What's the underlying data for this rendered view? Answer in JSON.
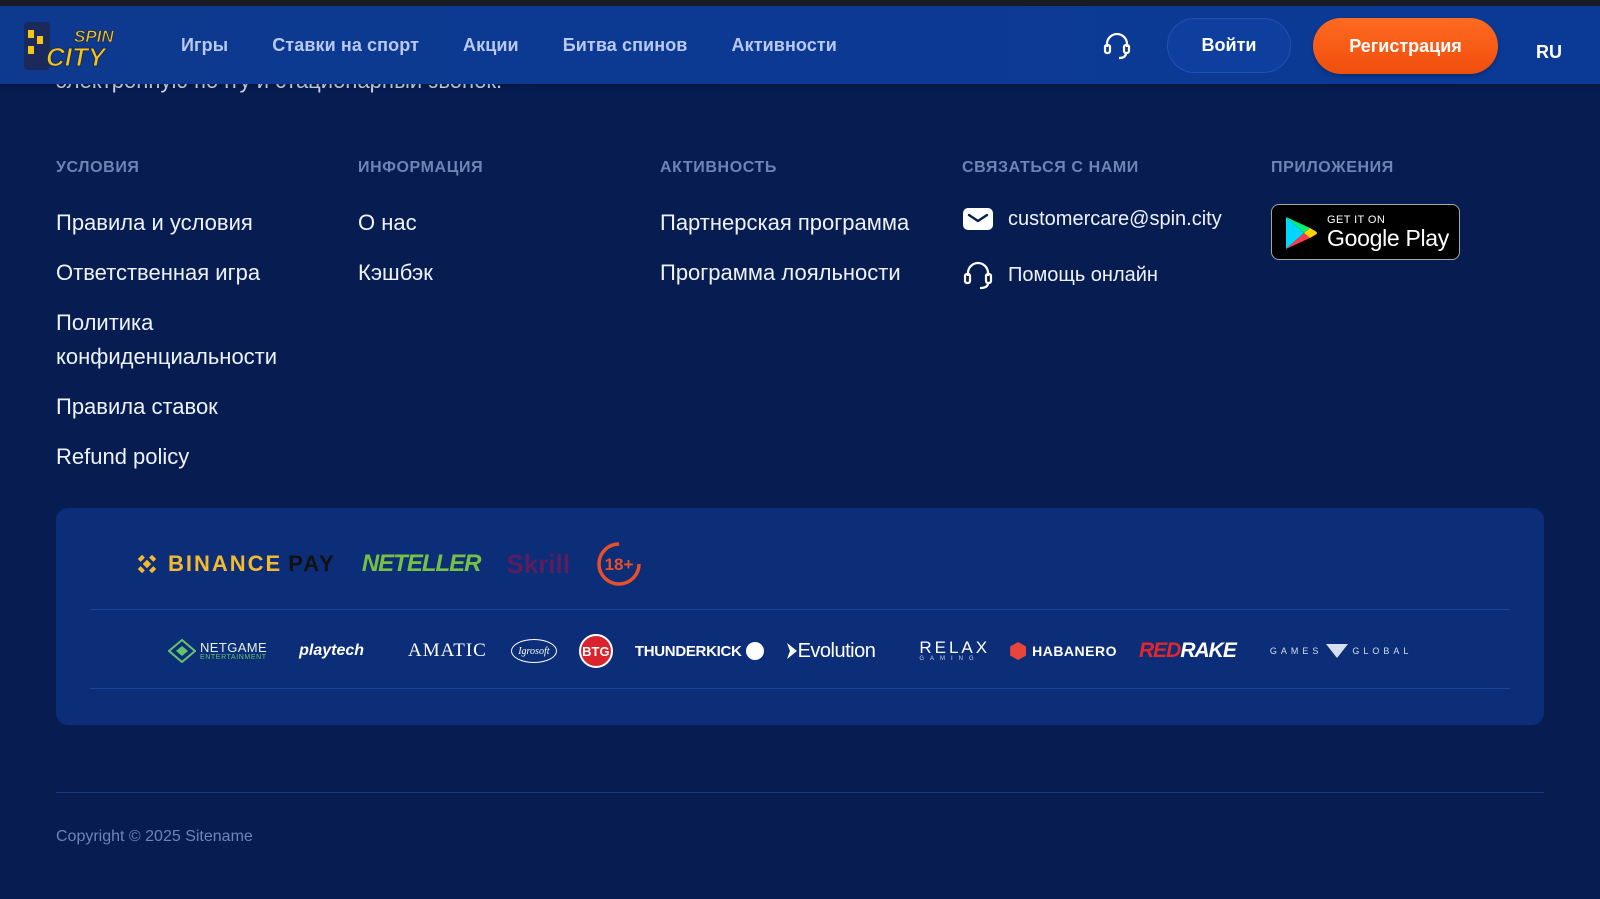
{
  "header": {
    "logo_text_top": "SPIN",
    "logo_text_bottom": "CITY",
    "nav": [
      "Игры",
      "Ставки на спорт",
      "Акции",
      "Битва спинов",
      "Активности"
    ],
    "login_label": "Войти",
    "register_label": "Регистрация",
    "language": "RU"
  },
  "intro_cut_text": "электронную почту и стационарный звонок.",
  "footer": {
    "columns": [
      {
        "title": "УСЛОВИЯ",
        "links": [
          "Правила и условия",
          "Ответственная игра",
          "Политика конфиденциальности",
          "Правила ставок",
          "Refund policy"
        ]
      },
      {
        "title": "ИНФОРМАЦИЯ",
        "links": [
          "О нас",
          "Кэшбэк"
        ]
      },
      {
        "title": "АКТИВНОСТЬ",
        "links": [
          "Партнерская программа",
          "Программа лояльности"
        ]
      }
    ],
    "contact": {
      "title": "СВЯЗАТЬСЯ С НАМИ",
      "email": "customercare@spin.city",
      "support": "Помощь онлайн"
    },
    "apps": {
      "title": "ПРИЛОЖЕНИЯ",
      "store_small": "GET IT ON",
      "store_big": "Google Play"
    },
    "payments": {
      "binance_1": "BINANCE",
      "binance_2": "PAY",
      "neteller": "NETELLER",
      "skrill": "Skrill",
      "age": "18+"
    },
    "providers": {
      "netgame_1": "NETGAME",
      "netgame_2": "ENTERTAINMENT",
      "playtech": "playtech",
      "amatic": "AMATIC",
      "igrosoft": "Igrosoft",
      "btg": "BTG",
      "thunderkick": "THUNDERKICK",
      "evolution": "Evolution",
      "relax_1": "RELAX",
      "relax_2": "GAMING",
      "habanero": "HABANERO",
      "redrake_1": "RED",
      "redrake_2": "RAKE",
      "games_global_1": "GAMES",
      "games_global_2": "GLOBAL"
    },
    "copyright": "Copyright © 2025 Sitename"
  },
  "colors": {
    "background": "#071d52",
    "header": "#0c3993",
    "accent_orange": "#f04e0c",
    "muted_title": "#6f84b5",
    "panel": "#0c2d78"
  }
}
